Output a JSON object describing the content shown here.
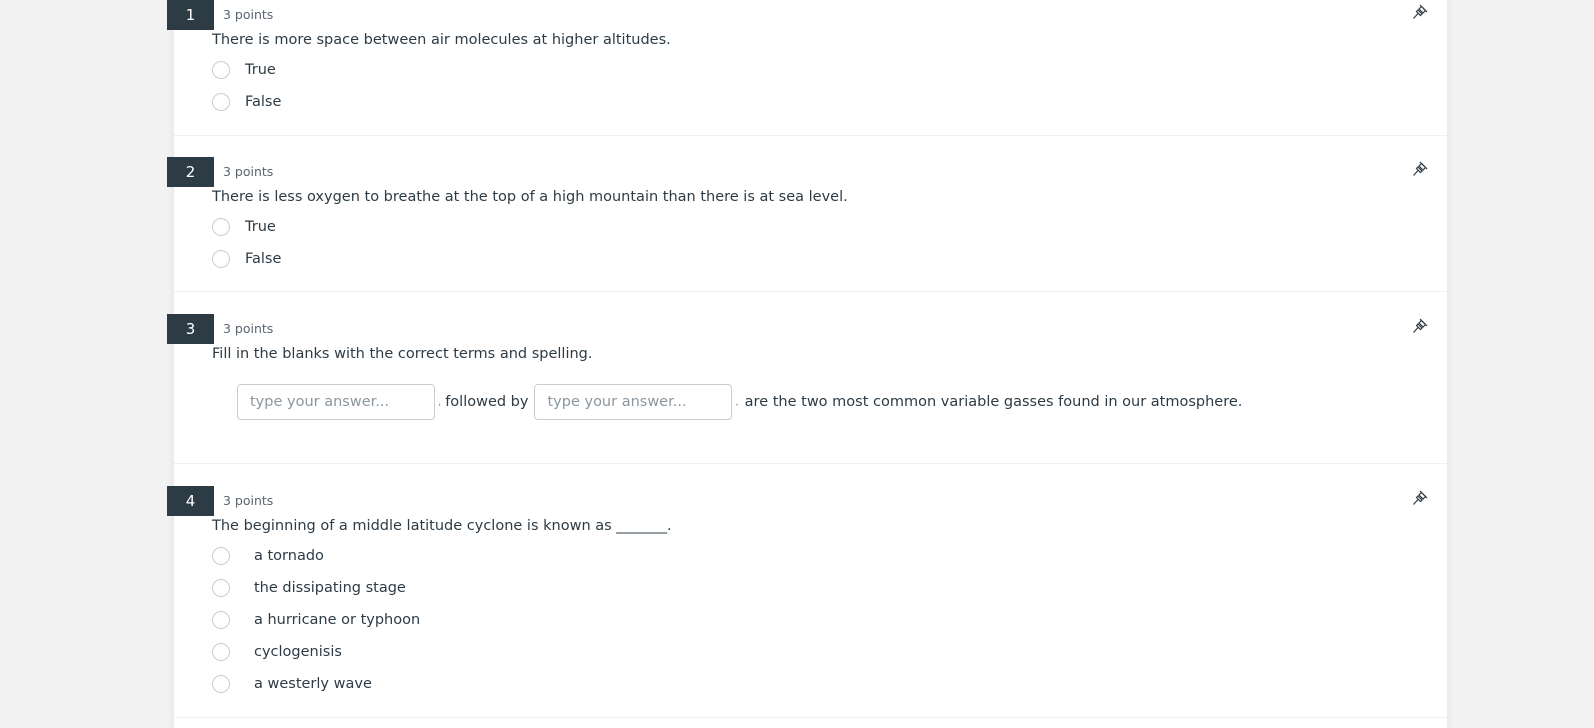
{
  "questions": [
    {
      "number": "1",
      "points": "3 points",
      "text": "There is more space between air molecules at higher altitudes.",
      "type": "true-false",
      "options": [
        "True",
        "False"
      ]
    },
    {
      "number": "2",
      "points": "3 points",
      "text": "There is less oxygen to breathe at the top of a high mountain than there is at sea level.",
      "type": "true-false",
      "options": [
        "True",
        "False"
      ]
    },
    {
      "number": "3",
      "points": "3 points",
      "text": "Fill in the blanks with the correct terms and spelling.",
      "type": "fill-in-blanks",
      "blanks": [
        {
          "placeholder": "type your answer...",
          "value": ""
        },
        {
          "placeholder": "type your answer...",
          "value": ""
        }
      ],
      "comma": ",",
      "connector": "followed by",
      "suffix": "are the two most common variable gasses found in our atmosphere."
    },
    {
      "number": "4",
      "points": "3 points",
      "text": "The beginning of a middle latitude cyclone is known as _______.",
      "type": "multiple-choice",
      "options": [
        "a tornado",
        "the dissipating stage",
        "a hurricane or typhoon",
        "cyclogenisis",
        "a westerly wave"
      ]
    }
  ],
  "icons": {
    "pin": "pin-icon"
  },
  "colors": {
    "badge_bg": "#2d3b45",
    "page_bg": "#f2f2f2",
    "text": "#2d3b45"
  }
}
